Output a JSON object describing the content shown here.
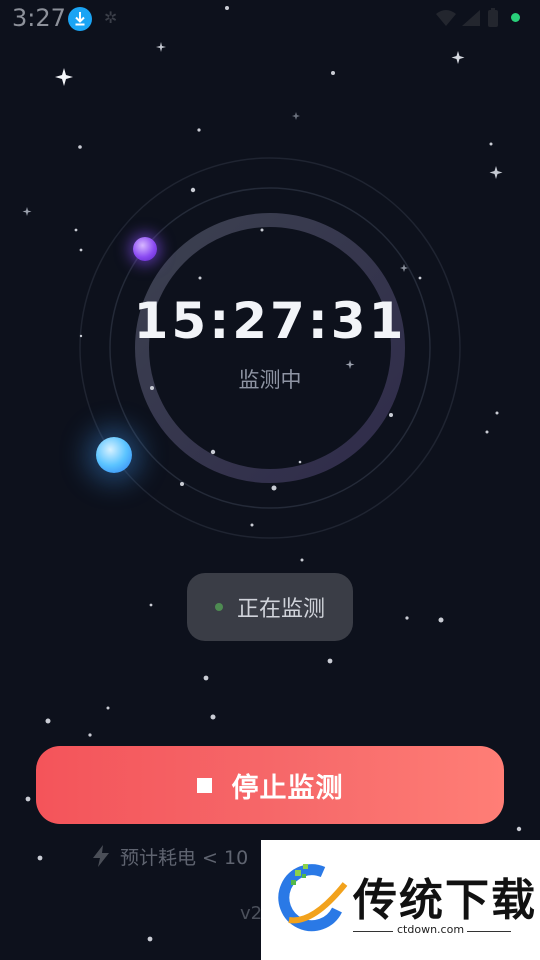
{
  "status_bar": {
    "time": "3:27",
    "icons": [
      "download-icon",
      "settings-icon",
      "wifi-icon",
      "signal-icon",
      "battery-icon",
      "status-dot"
    ]
  },
  "timer": {
    "time": "15:27:31",
    "status": "监测中"
  },
  "state_pill": {
    "label": "正在监测"
  },
  "stop_button": {
    "label": "停止监测",
    "icon": "stop-icon"
  },
  "power_note": {
    "icon": "lightning-icon",
    "text": "预计耗电 < 10"
  },
  "version": {
    "text": "v2"
  },
  "watermark": {
    "title": "传统下载",
    "url": "ctdown.com"
  },
  "colors": {
    "background": "#0d111c",
    "button_gradient_start": "#f4545a",
    "button_gradient_end": "#ff7e76",
    "pill_bg": "#3a3d46",
    "status_green": "#29d07a"
  }
}
